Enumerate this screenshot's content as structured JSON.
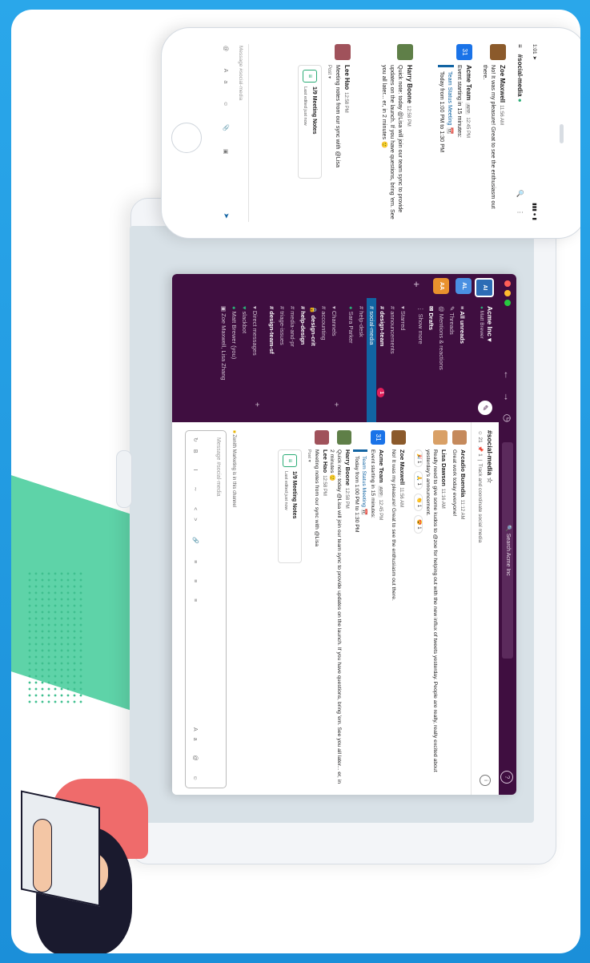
{
  "desktop": {
    "search": "Search Acme Inc",
    "workspace_rail": [
      "AI",
      "AL",
      "AA"
    ],
    "workspace_colors": [
      "#2d6cb5",
      "#4a90e2",
      "#e8912d"
    ],
    "workspace_name": "Acme Inc",
    "user_name": "Matt Brewer",
    "nav": [
      "All unreads",
      "Threads",
      "Mentions & reactions",
      "Drafts",
      "Show more"
    ],
    "starred_header": "Starred",
    "starred": [
      "announcements",
      "design-team",
      "social-media",
      "help-desk",
      "Sara Parker"
    ],
    "active_channel": "social-media",
    "unread_badge": "1",
    "channels_header": "Channels",
    "channels": [
      "accounting",
      "design-crit",
      "help-design",
      "media-and-pr",
      "triage-issues",
      "design-team-sf"
    ],
    "dm_header": "Direct messages",
    "dms": [
      "slackbot",
      "Matt Brewer (you)",
      "Zoe Maxwell, Lisa Zhang"
    ],
    "channel_header": {
      "name": "#social-media",
      "topic": "Track and coordinate social media"
    },
    "messages": [
      {
        "author": "Arcadio Buendía",
        "time": "11:12 AM",
        "text": "Great work today everyone!"
      },
      {
        "author": "Lisa Dawson",
        "time": "11:16 AM",
        "text": "Really need to give some kudos to @zoe for helping out with the new influx of tweets yesterday. People are really, really excited about yesterday's announcement.",
        "reactions": [
          "1",
          "1",
          "1",
          "1"
        ]
      },
      {
        "author": "Zoe Maxwell",
        "time": "11:56 AM",
        "text": "No! It was my pleasure! Great to see the enthusiasm out there."
      },
      {
        "author": "Acme Team",
        "app": "APP",
        "time": "12:45 PM",
        "text": "Event starting in 15 minutes:",
        "quote_title": "Team Status Meeting",
        "quote_text": "Today from 1:00 PM to 1:30 PM"
      },
      {
        "author": "Harry Boone",
        "time": "12:58 PM",
        "text": "Quick note: today @Lisa will join our team sync to provide updates on the launch. If you have questions, bring 'em. See you all later... er, in 2 minutes"
      },
      {
        "author": "Lee Hao",
        "time": "12:58 PM",
        "text": "Meeting notes from our sync with @Lisa",
        "post_label": "Post",
        "post_title": "1/9 Meeting Notes",
        "post_sub": "Last edited just now"
      }
    ],
    "zenith": "Zenith Marketing is in this channel",
    "composer_placeholder": "Message #social-media"
  },
  "phone": {
    "time": "1:01",
    "channel": "#social-media",
    "messages": [
      {
        "author": "Zoe Maxwell",
        "time": "11:56 AM",
        "text": "No! It was my pleasure! Great to see the enthusiasm out there."
      },
      {
        "author": "Acme Team",
        "app": "APP",
        "time": "12:45 PM",
        "text": "Event starting in 15 minutes:",
        "quote_title": "Team Status Meeting",
        "quote_text": "Today from 1:00 PM to 1:30 PM"
      },
      {
        "author": "Harry Boone",
        "time": "12:58 PM",
        "text": "Quick note: today @Lisa will join our team sync to provide updates on the launch. If you have questions, bring 'em. See you all later... er, in 2 minutes"
      },
      {
        "author": "Lee Hao",
        "time": "12:58 PM",
        "text": "Meeting notes from our sync with @Lisa",
        "post_label": "Post",
        "post_title": "1/9 Meeting Notes",
        "post_sub": "Last edited just now"
      }
    ],
    "composer_placeholder": "Message #social-media",
    "composer_aa": "Aa"
  },
  "colors": {
    "aubergine": "#3f0e40",
    "active": "#1164a3",
    "accent_green": "#5ed3a8",
    "background_blue": "#1e9be4"
  }
}
